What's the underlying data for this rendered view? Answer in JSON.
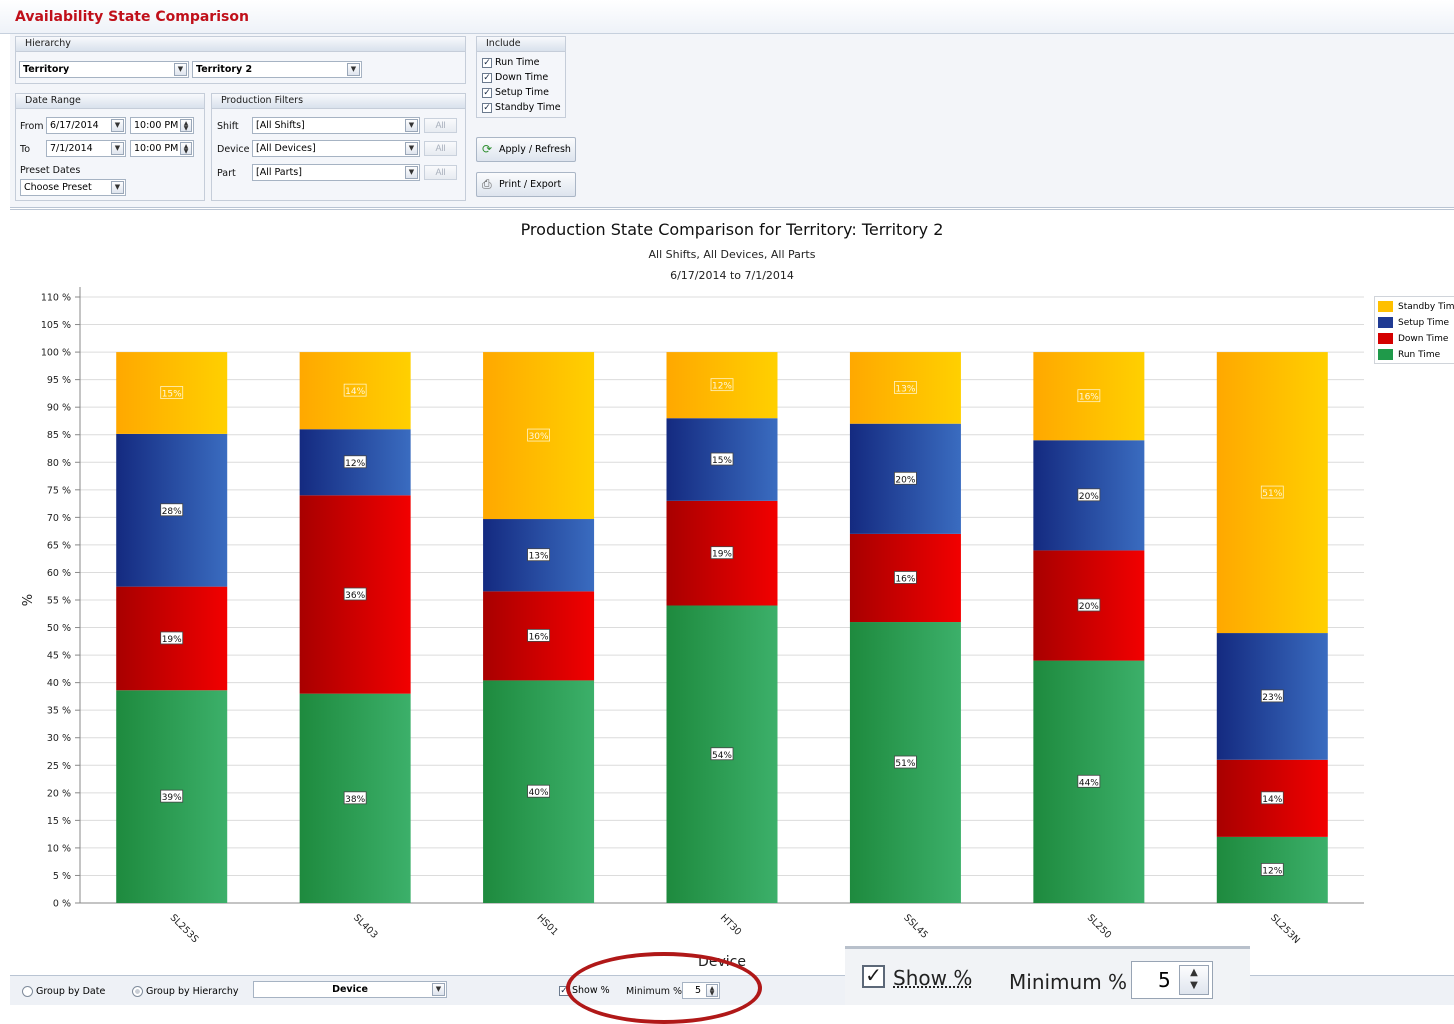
{
  "app": {
    "title": "Availability State Comparison"
  },
  "hierarchy": {
    "header": "Hierarchy",
    "level": "Territory",
    "value": "Territory 2"
  },
  "include": {
    "header": "Include",
    "items": [
      "Run Time",
      "Down Time",
      "Setup Time",
      "Standby Time"
    ],
    "checked": [
      true,
      true,
      true,
      true
    ]
  },
  "date_range": {
    "header": "Date Range",
    "from_label": "From",
    "from_date": "6/17/2014",
    "from_time": "10:00 PM",
    "to_label": "To",
    "to_date": "7/1/2014",
    "to_time": "10:00 PM",
    "preset_label": "Preset Dates",
    "preset_value": "Choose Preset"
  },
  "production_filters": {
    "header": "Production Filters",
    "shift_label": "Shift",
    "shift_value": "[All Shifts]",
    "device_label": "Device",
    "device_value": "[All Devices]",
    "part_label": "Part",
    "part_value": "[All Parts]",
    "all_label": "All"
  },
  "actions": {
    "apply": "Apply / Refresh",
    "print": "Print / Export"
  },
  "colors": {
    "standby": "#ffc000",
    "setup": "#1f3a93",
    "down": "#d40000",
    "run": "#1f9a4a",
    "title_red": "#c0101a"
  },
  "chart_data": {
    "type": "bar",
    "stacked": true,
    "title": "Production State Comparison for Territory: Territory 2",
    "subtitle1": "All Shifts, All Devices, All Parts",
    "subtitle2": "6/17/2014 to 7/1/2014",
    "ylabel": "%",
    "xlabel": "Device",
    "ylim": [
      0,
      110
    ],
    "yticks": [
      0,
      5,
      10,
      15,
      20,
      25,
      30,
      35,
      40,
      45,
      50,
      55,
      60,
      65,
      70,
      75,
      80,
      85,
      90,
      95,
      100,
      105,
      110
    ],
    "categories": [
      "SL253S",
      "SL403",
      "HS01",
      "HT30",
      "SSL45",
      "SL250",
      "SL253N"
    ],
    "series": [
      {
        "name": "Run Time",
        "color": "run",
        "values": [
          39,
          38,
          40,
          54,
          51,
          44,
          12
        ]
      },
      {
        "name": "Down Time",
        "color": "down",
        "values": [
          19,
          36,
          16,
          19,
          16,
          20,
          14
        ]
      },
      {
        "name": "Setup Time",
        "color": "setup",
        "values": [
          28,
          12,
          13,
          15,
          20,
          20,
          23
        ]
      },
      {
        "name": "Standby Time",
        "color": "standby",
        "values": [
          15,
          14,
          30,
          12,
          13,
          16,
          51
        ]
      }
    ],
    "legend": [
      "Standby Time",
      "Setup Time",
      "Down Time",
      "Run Time"
    ],
    "legend_position": "right",
    "grid": true
  },
  "bottom": {
    "group_by_date": "Group by Date",
    "group_by_hierarchy": "Group by Hierarchy",
    "group_value": "Device",
    "show_pct": "Show %",
    "minimum_label": "Minimum %",
    "minimum_value": "5"
  }
}
